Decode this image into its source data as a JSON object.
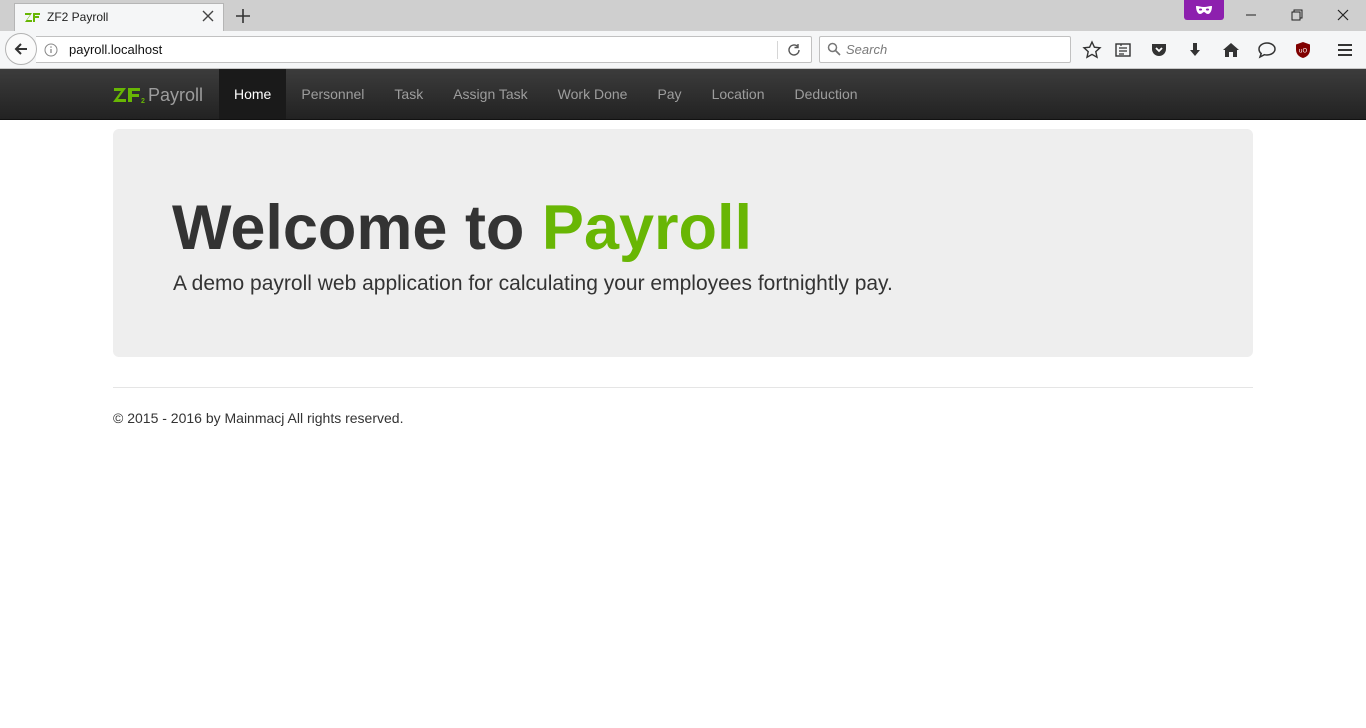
{
  "browser": {
    "tab": {
      "title": "ZF2 Payroll"
    },
    "url": "payroll.localhost",
    "search": {
      "placeholder": "Search"
    },
    "toolbar_icons": [
      "bookmark-star-icon",
      "reading-list-icon",
      "pocket-icon",
      "downloads-icon",
      "home-icon",
      "chat-icon",
      "ublock-icon",
      "menu-icon"
    ],
    "window_controls": [
      "minimize-icon",
      "restore-icon",
      "close-icon"
    ]
  },
  "site": {
    "brand": {
      "logo": "ZF2",
      "name": "Payroll"
    },
    "nav": [
      {
        "label": "Home",
        "active": true
      },
      {
        "label": "Personnel",
        "active": false
      },
      {
        "label": "Task",
        "active": false
      },
      {
        "label": "Assign Task",
        "active": false
      },
      {
        "label": "Work Done",
        "active": false
      },
      {
        "label": "Pay",
        "active": false
      },
      {
        "label": "Location",
        "active": false
      },
      {
        "label": "Deduction",
        "active": false
      }
    ],
    "jumbotron": {
      "title_prefix": "Welcome to ",
      "title_accent": "Payroll",
      "lead": "A demo payroll web application for calculating your employees fortnightly pay."
    },
    "footer": {
      "text": "© 2015 - 2016 by Mainmacj All rights reserved."
    }
  },
  "colors": {
    "accent_green": "#68b604",
    "navbar_dark": "#222222",
    "jumbotron_bg": "#eeeeee",
    "private_purple": "#8d20ae"
  }
}
